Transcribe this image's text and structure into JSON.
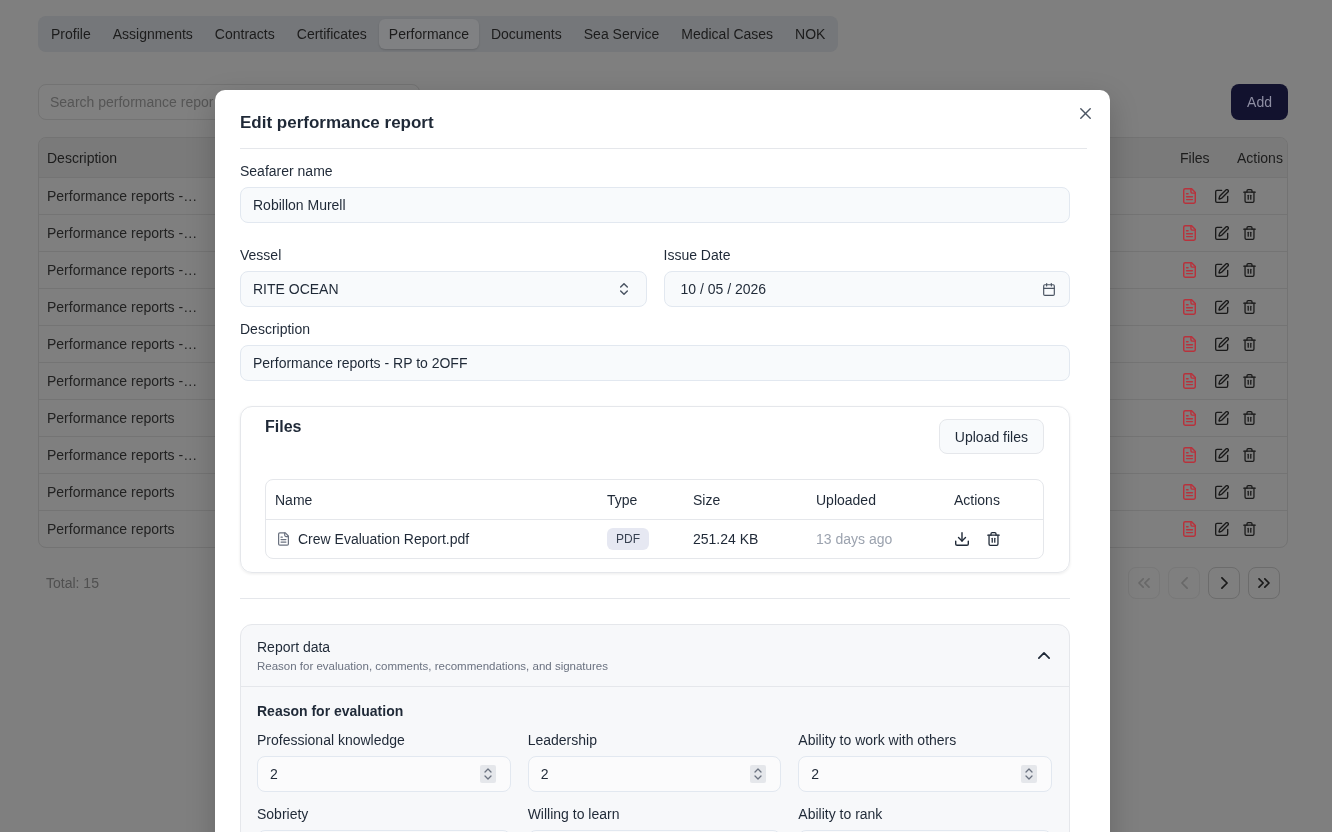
{
  "tabs": [
    {
      "label": "Profile",
      "selected": false
    },
    {
      "label": "Assignments",
      "selected": false
    },
    {
      "label": "Contracts",
      "selected": false
    },
    {
      "label": "Certificates",
      "selected": false
    },
    {
      "label": "Performance",
      "selected": true
    },
    {
      "label": "Documents",
      "selected": false
    },
    {
      "label": "Sea Service",
      "selected": false
    },
    {
      "label": "Medical Cases",
      "selected": false
    },
    {
      "label": "NOK",
      "selected": false
    }
  ],
  "search": {
    "placeholder": "Search performance repor"
  },
  "add_button": "Add",
  "table": {
    "columns": [
      "Description",
      "Files",
      "Actions"
    ],
    "rows": [
      {
        "description": "Performance reports -…"
      },
      {
        "description": "Performance reports -…"
      },
      {
        "description": "Performance reports -…"
      },
      {
        "description": "Performance reports -…"
      },
      {
        "description": "Performance reports -…"
      },
      {
        "description": "Performance reports -…"
      },
      {
        "description": "Performance reports"
      },
      {
        "description": "Performance reports -…"
      },
      {
        "description": "Performance reports"
      },
      {
        "description": "Performance reports"
      }
    ]
  },
  "total": "Total: 15",
  "pagination": [
    {
      "kind": "first",
      "disabled": true
    },
    {
      "kind": "previous",
      "disabled": true
    },
    {
      "kind": "next",
      "disabled": false
    },
    {
      "kind": "last",
      "disabled": false
    }
  ],
  "dialog": {
    "title": "Edit performance report",
    "field_rows": [
      {
        "fields": [
          {
            "kind": "text",
            "label": "Seafarer name",
            "value": "Robillon Murell"
          }
        ]
      },
      {
        "fields": [
          {
            "kind": "select",
            "label": "Vessel",
            "value": "RITE OCEAN"
          },
          {
            "kind": "date",
            "label": "Issue Date",
            "value": "10 / 05 / 2026"
          }
        ]
      },
      {
        "fields": [
          {
            "kind": "text",
            "label": "Description",
            "value": "Performance reports - RP to 2OFF"
          }
        ]
      }
    ],
    "files": {
      "title": "Files",
      "upload_button": "Upload files",
      "columns": [
        "Name",
        "Type",
        "Size",
        "Uploaded",
        "Actions"
      ],
      "rows": [
        {
          "name": "Crew Evaluation Report.pdf",
          "type": "PDF",
          "size": "251.24 KB",
          "uploaded": "13 days ago"
        }
      ]
    },
    "report_data": {
      "title": "Report data",
      "subtitle": "Reason for evaluation, comments, recommendations, and signatures",
      "expanded": true,
      "section_title": "Reason for evaluation",
      "fields": [
        {
          "label": "Professional knowledge",
          "value": "2"
        },
        {
          "label": "Leadership",
          "value": "2"
        },
        {
          "label": "Ability to work with others",
          "value": "2"
        },
        {
          "label": "Sobriety"
        },
        {
          "label": "Willing to learn"
        },
        {
          "label": "Ability to rank"
        }
      ]
    }
  }
}
